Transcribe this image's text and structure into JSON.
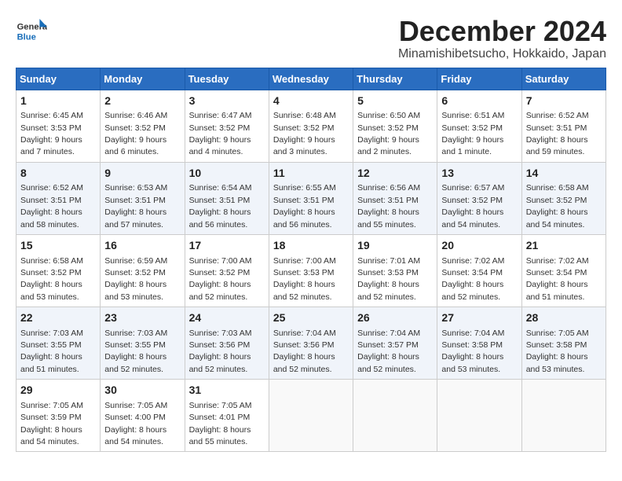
{
  "logo": {
    "general": "General",
    "blue": "Blue"
  },
  "title": "December 2024",
  "location": "Minamishibetsucho, Hokkaido, Japan",
  "weekdays": [
    "Sunday",
    "Monday",
    "Tuesday",
    "Wednesday",
    "Thursday",
    "Friday",
    "Saturday"
  ],
  "weeks": [
    [
      {
        "day": "1",
        "sunrise": "6:45 AM",
        "sunset": "3:53 PM",
        "daylight": "9 hours and 7 minutes."
      },
      {
        "day": "2",
        "sunrise": "6:46 AM",
        "sunset": "3:52 PM",
        "daylight": "9 hours and 6 minutes."
      },
      {
        "day": "3",
        "sunrise": "6:47 AM",
        "sunset": "3:52 PM",
        "daylight": "9 hours and 4 minutes."
      },
      {
        "day": "4",
        "sunrise": "6:48 AM",
        "sunset": "3:52 PM",
        "daylight": "9 hours and 3 minutes."
      },
      {
        "day": "5",
        "sunrise": "6:50 AM",
        "sunset": "3:52 PM",
        "daylight": "9 hours and 2 minutes."
      },
      {
        "day": "6",
        "sunrise": "6:51 AM",
        "sunset": "3:52 PM",
        "daylight": "9 hours and 1 minute."
      },
      {
        "day": "7",
        "sunrise": "6:52 AM",
        "sunset": "3:51 PM",
        "daylight": "8 hours and 59 minutes."
      }
    ],
    [
      {
        "day": "8",
        "sunrise": "6:52 AM",
        "sunset": "3:51 PM",
        "daylight": "8 hours and 58 minutes."
      },
      {
        "day": "9",
        "sunrise": "6:53 AM",
        "sunset": "3:51 PM",
        "daylight": "8 hours and 57 minutes."
      },
      {
        "day": "10",
        "sunrise": "6:54 AM",
        "sunset": "3:51 PM",
        "daylight": "8 hours and 56 minutes."
      },
      {
        "day": "11",
        "sunrise": "6:55 AM",
        "sunset": "3:51 PM",
        "daylight": "8 hours and 56 minutes."
      },
      {
        "day": "12",
        "sunrise": "6:56 AM",
        "sunset": "3:51 PM",
        "daylight": "8 hours and 55 minutes."
      },
      {
        "day": "13",
        "sunrise": "6:57 AM",
        "sunset": "3:52 PM",
        "daylight": "8 hours and 54 minutes."
      },
      {
        "day": "14",
        "sunrise": "6:58 AM",
        "sunset": "3:52 PM",
        "daylight": "8 hours and 54 minutes."
      }
    ],
    [
      {
        "day": "15",
        "sunrise": "6:58 AM",
        "sunset": "3:52 PM",
        "daylight": "8 hours and 53 minutes."
      },
      {
        "day": "16",
        "sunrise": "6:59 AM",
        "sunset": "3:52 PM",
        "daylight": "8 hours and 53 minutes."
      },
      {
        "day": "17",
        "sunrise": "7:00 AM",
        "sunset": "3:52 PM",
        "daylight": "8 hours and 52 minutes."
      },
      {
        "day": "18",
        "sunrise": "7:00 AM",
        "sunset": "3:53 PM",
        "daylight": "8 hours and 52 minutes."
      },
      {
        "day": "19",
        "sunrise": "7:01 AM",
        "sunset": "3:53 PM",
        "daylight": "8 hours and 52 minutes."
      },
      {
        "day": "20",
        "sunrise": "7:02 AM",
        "sunset": "3:54 PM",
        "daylight": "8 hours and 52 minutes."
      },
      {
        "day": "21",
        "sunrise": "7:02 AM",
        "sunset": "3:54 PM",
        "daylight": "8 hours and 51 minutes."
      }
    ],
    [
      {
        "day": "22",
        "sunrise": "7:03 AM",
        "sunset": "3:55 PM",
        "daylight": "8 hours and 51 minutes."
      },
      {
        "day": "23",
        "sunrise": "7:03 AM",
        "sunset": "3:55 PM",
        "daylight": "8 hours and 52 minutes."
      },
      {
        "day": "24",
        "sunrise": "7:03 AM",
        "sunset": "3:56 PM",
        "daylight": "8 hours and 52 minutes."
      },
      {
        "day": "25",
        "sunrise": "7:04 AM",
        "sunset": "3:56 PM",
        "daylight": "8 hours and 52 minutes."
      },
      {
        "day": "26",
        "sunrise": "7:04 AM",
        "sunset": "3:57 PM",
        "daylight": "8 hours and 52 minutes."
      },
      {
        "day": "27",
        "sunrise": "7:04 AM",
        "sunset": "3:58 PM",
        "daylight": "8 hours and 53 minutes."
      },
      {
        "day": "28",
        "sunrise": "7:05 AM",
        "sunset": "3:58 PM",
        "daylight": "8 hours and 53 minutes."
      }
    ],
    [
      {
        "day": "29",
        "sunrise": "7:05 AM",
        "sunset": "3:59 PM",
        "daylight": "8 hours and 54 minutes."
      },
      {
        "day": "30",
        "sunrise": "7:05 AM",
        "sunset": "4:00 PM",
        "daylight": "8 hours and 54 minutes."
      },
      {
        "day": "31",
        "sunrise": "7:05 AM",
        "sunset": "4:01 PM",
        "daylight": "8 hours and 55 minutes."
      },
      null,
      null,
      null,
      null
    ]
  ]
}
